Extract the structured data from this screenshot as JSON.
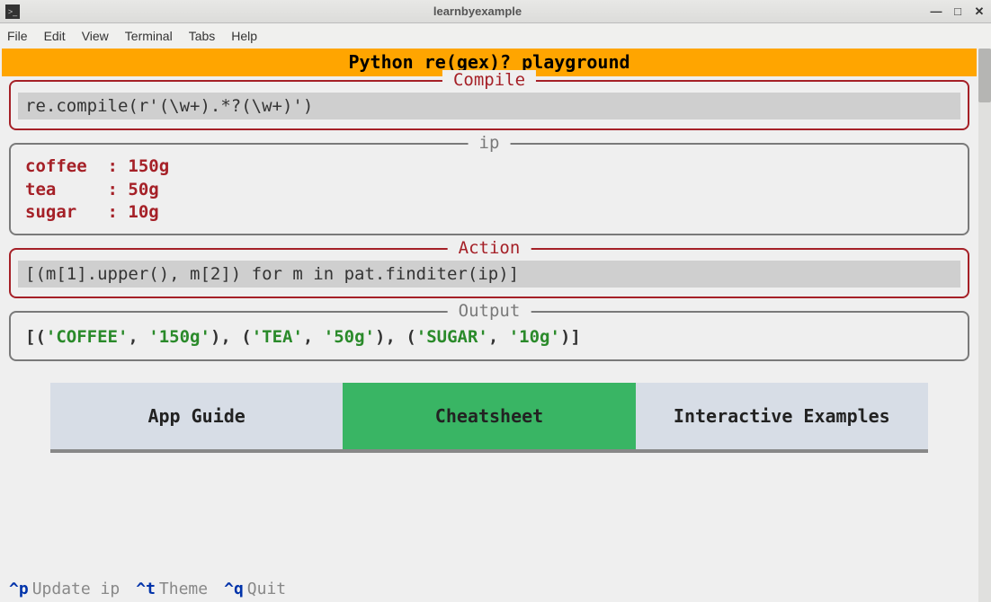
{
  "window": {
    "title": "learnbyexample",
    "icon_glyph": ">_"
  },
  "menubar": [
    "File",
    "Edit",
    "View",
    "Terminal",
    "Tabs",
    "Help"
  ],
  "banner": "Python re(gex)? playground",
  "panels": {
    "compile": {
      "label": "Compile",
      "value": "re.compile(r'(\\w+).*?(\\w+)')"
    },
    "ip": {
      "label": "ip",
      "value": "coffee  : 150g\ntea     : 50g\nsugar   : 10g"
    },
    "action": {
      "label": "Action",
      "value": "[(m[1].upper(), m[2]) for m in pat.finditer(ip)]"
    },
    "output": {
      "label": "Output",
      "pairs": [
        [
          "'COFFEE'",
          "'150g'"
        ],
        [
          "'TEA'",
          "'50g'"
        ],
        [
          "'SUGAR'",
          "'10g'"
        ]
      ]
    }
  },
  "tabs": [
    {
      "label": "App Guide",
      "active": false
    },
    {
      "label": "Cheatsheet",
      "active": true
    },
    {
      "label": "Interactive Examples",
      "active": false
    }
  ],
  "footer": [
    {
      "key": "^p",
      "desc": "Update ip"
    },
    {
      "key": "^t",
      "desc": "Theme"
    },
    {
      "key": "^q",
      "desc": "Quit"
    }
  ]
}
